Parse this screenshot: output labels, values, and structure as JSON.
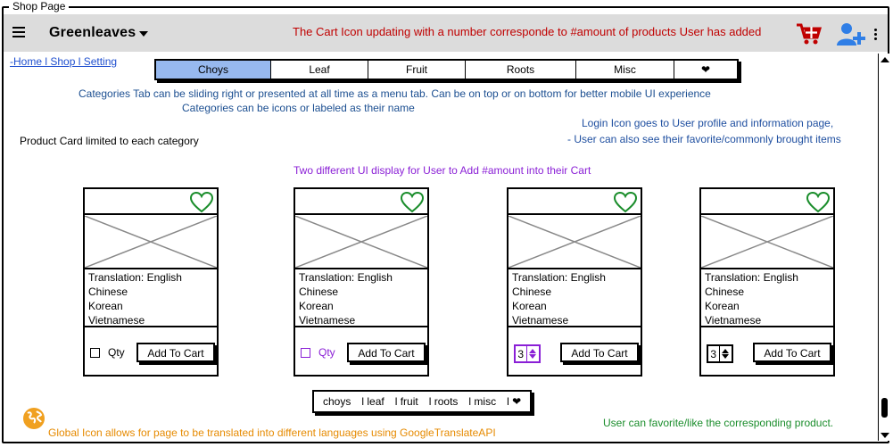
{
  "window": {
    "title": "Shop Page"
  },
  "topbar": {
    "app_name": "Greenleaves",
    "note": "The Cart Icon updating with a number corresponde to #amount of products User has added",
    "icons": {
      "menu": "hamburger-icon",
      "cart": "add-to-cart-icon",
      "user": "add-user-icon",
      "more": "more-vertical-icon"
    }
  },
  "breadcrumb": "-Home l Shop l Setting",
  "tabs": [
    {
      "label": "Choys",
      "active": true
    },
    {
      "label": "Leaf"
    },
    {
      "label": "Fruit"
    },
    {
      "label": "Roots"
    },
    {
      "label": "Misc"
    },
    {
      "label": "❤"
    }
  ],
  "notes": {
    "categories_1": "Categories Tab can be sliding right or presented at all time as a menu tab. Can be on top or on bottom for better mobile UI experience",
    "categories_2": "Categories can be icons or labeled as their name",
    "login_1": "Login Icon goes to User profile and information page,",
    "login_2": "- User can also see their favorite/commonly brought items",
    "product_card": "Product Card limited to each category",
    "two_ui": "Two different UI display for User to Add #amount into their Cart",
    "favorite": "User can favorite/like the corresponding product.",
    "global": "Global Icon allows for page to be translated into different languages using GoogleTranslateAPI"
  },
  "cards": [
    {
      "lines": [
        "Translation: English",
        "Chinese",
        "Korean",
        "Vietnamese"
      ],
      "qty_label": "Qty",
      "button": "Add To Cart"
    },
    {
      "lines": [
        "Translation: English",
        "Chinese",
        "Korean",
        "Vietnamese"
      ],
      "qty_label": "Qty",
      "button": "Add To Cart"
    },
    {
      "lines": [
        "Translation: English",
        "Chinese",
        "Korean",
        "Vietnamese"
      ],
      "stepper_value": "3",
      "button": "Add To Cart"
    },
    {
      "lines": [
        "Translation: English",
        "Chinese",
        "Korean",
        "Vietnamese"
      ],
      "stepper_value": "3",
      "button": "Add To Cart"
    }
  ],
  "bottom_tabs": [
    "choys",
    "l leaf",
    "l fruit",
    "l roots",
    "l misc",
    "l ❤"
  ],
  "colors": {
    "topbar": "#dcdcdc",
    "active_tab": "#97b9ef",
    "red": "#c00000",
    "purple": "#8a1fd6",
    "green": "#1a8d2b",
    "orange": "#e68a00"
  }
}
